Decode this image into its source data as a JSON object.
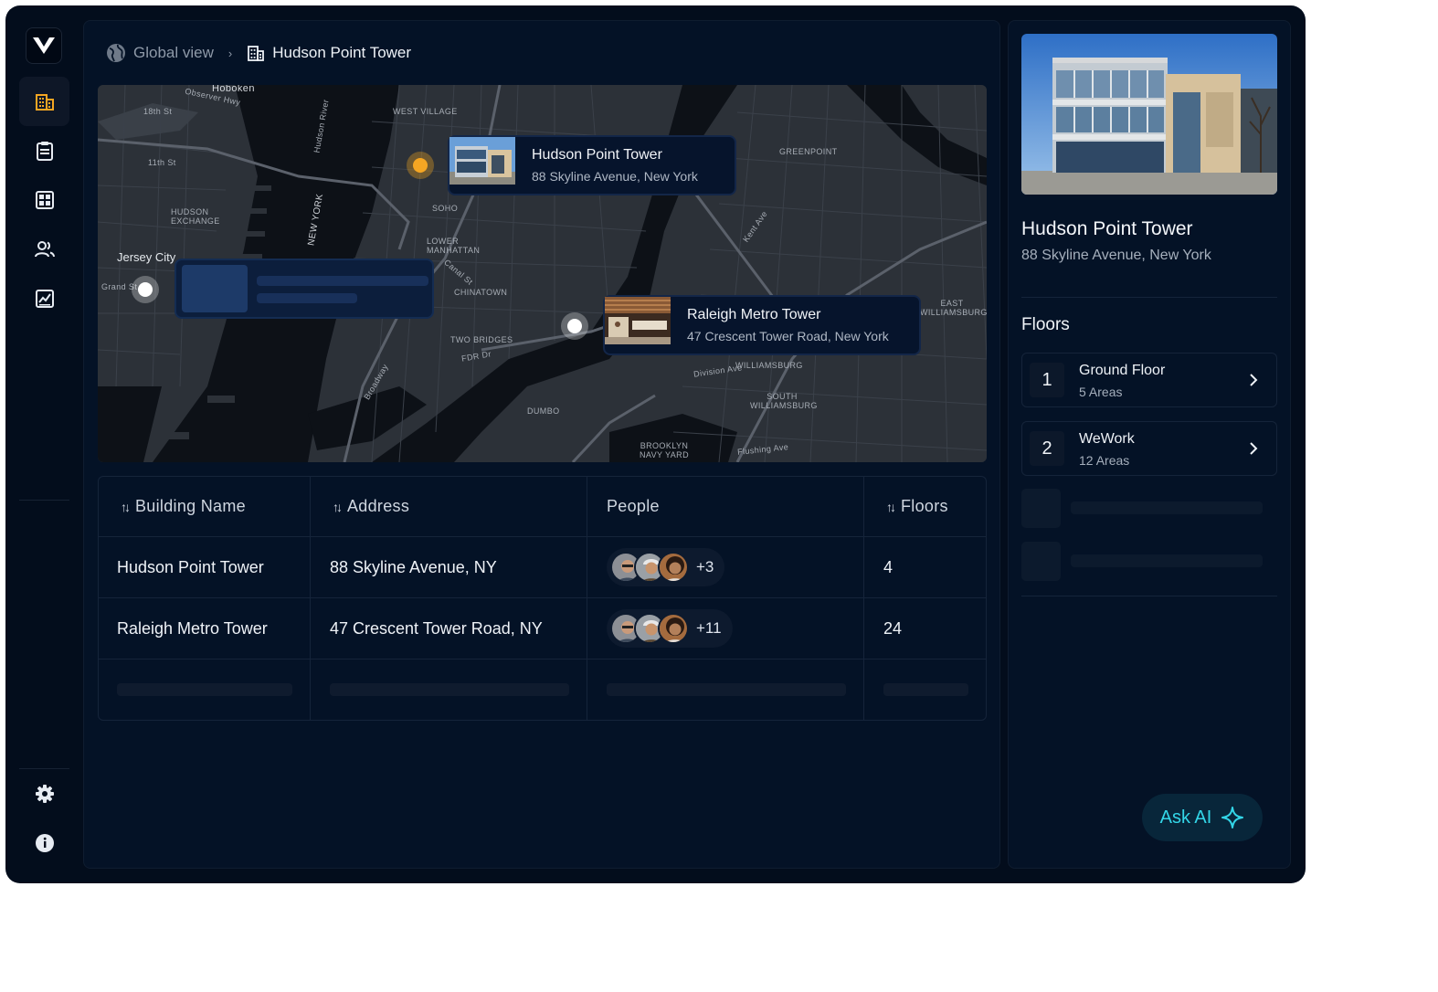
{
  "breadcrumb": {
    "root": "Global view",
    "current": "Hudson Point Tower"
  },
  "sidebar": {
    "items": [
      {
        "name": "buildings",
        "icon": "building-icon",
        "active": true
      },
      {
        "name": "reports",
        "icon": "clipboard-icon",
        "active": false
      },
      {
        "name": "areas",
        "icon": "grid-icon",
        "active": false
      },
      {
        "name": "people",
        "icon": "people-icon",
        "active": false
      },
      {
        "name": "analytics",
        "icon": "chart-icon",
        "active": false
      }
    ],
    "bottom": [
      {
        "name": "settings",
        "icon": "gear-icon"
      },
      {
        "name": "info",
        "icon": "info-icon"
      }
    ]
  },
  "map": {
    "labels": {
      "hoboken": "Hoboken",
      "observer_hwy": "Observer Hwy",
      "st_18": "18th St",
      "st_11": "11th St",
      "hudson_exchange": "HUDSON EXCHANGE",
      "jersey_city": "Jersey City",
      "grand_st_left": "Grand St",
      "west_village": "WEST VILLAGE",
      "soho": "SOHO",
      "lower_manhattan": "LOWER MANHATTAN",
      "chinatown": "CHINATOWN",
      "two_bridges": "TWO BRIDGES",
      "dumbo": "DUMBO",
      "brooklyn_navy_yard": "BROOKLYN NAVY YARD",
      "greenpoint": "GREENPOINT",
      "williamsburg": "WILLIAMSBURG",
      "east_williamsburg": "EAST WILLIAMSBURG",
      "south_williamsburg": "SOUTH WILLIAMSBURG",
      "new_york": "NEW YORK",
      "hudson_river": "Hudson River",
      "fdr_dr": "FDR Dr",
      "kent_ave": "Kent Ave",
      "division_ave": "Division Ave",
      "flushing_ave": "Flushing Ave",
      "broadway": "Broadway",
      "canal_st": "Canal St"
    },
    "cards": [
      {
        "title": "Hudson Point Tower",
        "address": "88 Skyline Avenue, New York"
      },
      {
        "title": "Raleigh Metro Tower",
        "address": "47 Crescent Tower Road, New York"
      }
    ]
  },
  "table": {
    "headers": {
      "name": "Building Name",
      "address": "Address",
      "people": "People",
      "floors": "Floors"
    },
    "rows": [
      {
        "name": "Hudson Point Tower",
        "address": "88 Skyline Avenue, NY",
        "people_more": "+3",
        "floors": "4"
      },
      {
        "name": "Raleigh Metro Tower",
        "address": "47 Crescent Tower Road, NY",
        "people_more": "+11",
        "floors": "24"
      }
    ]
  },
  "detail": {
    "title": "Hudson Point Tower",
    "address": "88 Skyline Avenue, New York",
    "floors_title": "Floors",
    "floors": [
      {
        "num": "1",
        "name": "Ground Floor",
        "areas": "5 Areas"
      },
      {
        "num": "2",
        "name": "WeWork",
        "areas": "12 Areas"
      }
    ]
  },
  "ask_ai": {
    "label": "Ask AI"
  },
  "colors": {
    "accent": "#33d6e8",
    "pin_active": "#f5a623",
    "background": "#030d1c",
    "panel": "#041226"
  }
}
